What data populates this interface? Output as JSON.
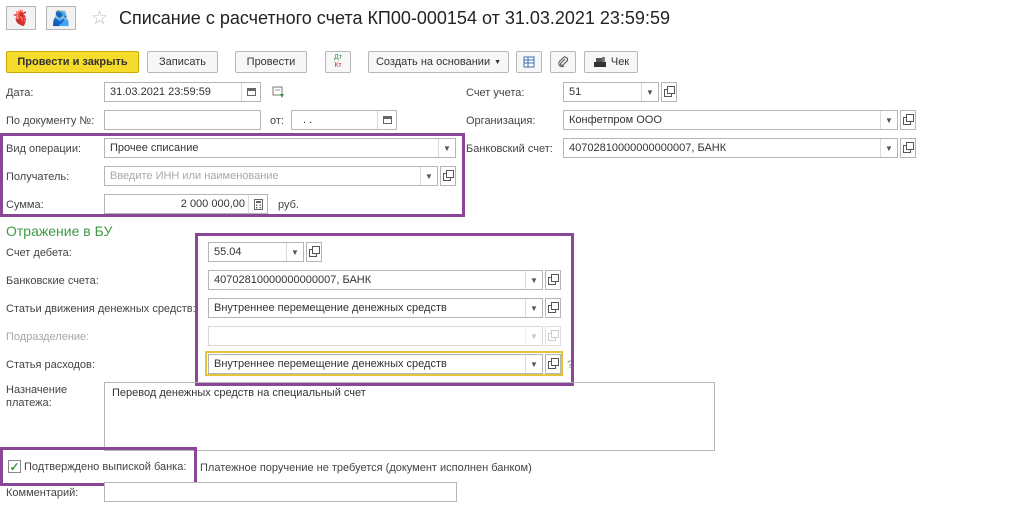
{
  "header": {
    "back_icon": "arrow-left-icon",
    "forward_icon": "arrow-right-icon",
    "title": "Списание с расчетного счета КП00-000154 от 31.03.2021 23:59:59"
  },
  "toolbar": {
    "post_close": "Провести и закрыть",
    "save": "Записать",
    "post": "Провести",
    "dt_kt_top": "Дт",
    "dt_kt_bottom": "Кт",
    "create_basis": "Создать на основании",
    "receipt": "Чек"
  },
  "form": {
    "date_label": "Дата:",
    "date_value": "31.03.2021 23:59:59",
    "doc_num_label": "По документу №:",
    "doc_num_value": "",
    "from_label": "от:",
    "from_value": ". .",
    "account_label": "Счет учета:",
    "account_value": "51",
    "org_label": "Организация:",
    "org_value": "Конфетпром ООО",
    "bank_account_label": "Банковский счет:",
    "bank_account_value": "40702810000000000007,  БАНК",
    "op_type_label": "Вид операции:",
    "op_type_value": "Прочее списание",
    "recipient_label": "Получатель:",
    "recipient_placeholder": "Введите ИНН или наименование",
    "sum_label": "Сумма:",
    "sum_value": "2 000 000,00",
    "currency": "руб."
  },
  "bu": {
    "section_title": "Отражение в БУ",
    "debit_label": "Счет дебета:",
    "debit_value": "55.04",
    "bank_accounts_label": "Банковские счета:",
    "bank_accounts_value": "40702810000000000007,  БАНК",
    "cash_flow_label": "Статьи движения денежных средств:",
    "cash_flow_value": "Внутреннее перемещение денежных средств",
    "division_label": "Подразделение:",
    "division_value": "",
    "expense_label": "Статья расходов:",
    "expense_value": "Внутреннее перемещение денежных средств",
    "expense_help": "?"
  },
  "payment": {
    "purpose_label_1": "Назначение",
    "purpose_label_2": "платежа:",
    "purpose_value": "Перевод денежных средств на специальный счет",
    "confirmed_label": "Подтверждено выпиской банка:",
    "confirmed_checked": true,
    "order_note": "Платежное поручение не требуется (документ исполнен банком)",
    "comment_label": "Комментарий:",
    "comment_value": ""
  },
  "colors": {
    "primary_button": "#f6dc2a",
    "highlight_frame": "#8a4797",
    "section_title": "#3e9a44",
    "focus_field": "#e4c43a"
  }
}
